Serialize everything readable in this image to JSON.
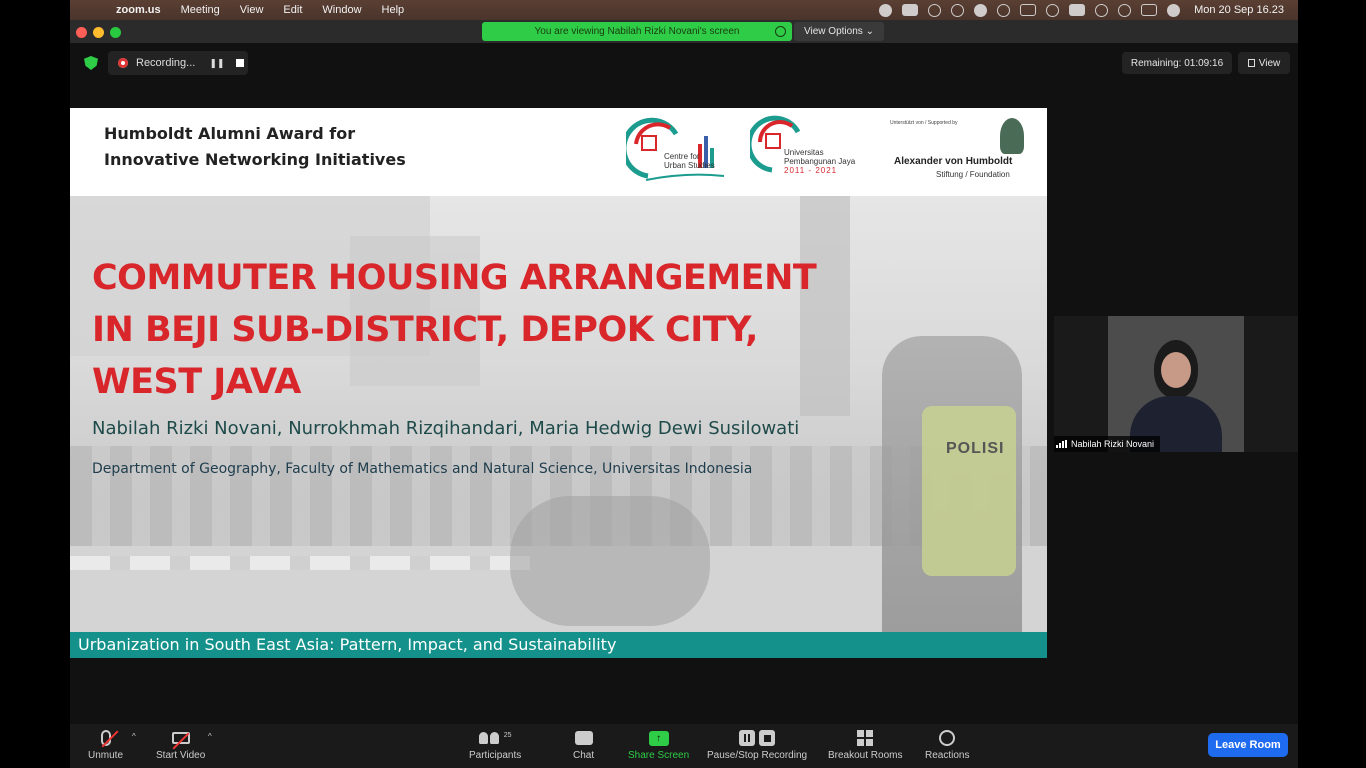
{
  "menubar": {
    "app": "zoom.us",
    "items": [
      "Meeting",
      "View",
      "Edit",
      "Window",
      "Help"
    ],
    "clock": "Mon 20 Sep  16.23"
  },
  "titlebar": {
    "viewing_banner": "You are viewing Nabilah Rizki Novani's screen",
    "view_options": "View Options"
  },
  "meeting": {
    "recording_label": "Recording...",
    "remaining": "Remaining: 01:09:16",
    "view_label": "View"
  },
  "slide": {
    "award_line1": "Humboldt Alumni Award for",
    "award_line2": "Innovative Networking Initiatives",
    "logo_centre": [
      "Centre for",
      "Urban Studies"
    ],
    "logo_university": [
      "Universitas",
      "Pembangunan Jaya",
      "2011 - 2021"
    ],
    "logo_vh_supported": "Unterstützt von / Supported by",
    "logo_vh_name": "Alexander von Humboldt",
    "logo_vh_sub": "Stiftung / Foundation",
    "title_lines": [
      "COMMUTER HOUSING ARRANGEMENT",
      "IN BEJI SUB-DISTRICT, DEPOK CITY,",
      "WEST JAVA"
    ],
    "authors": "Nabilah Rizki Novani, Nurrokhmah Rizqihandari, Maria Hedwig Dewi Susilowati",
    "department": "Department of Geography, Faculty of Mathematics and Natural Science, Universitas Indonesia",
    "footer": "Urbanization in South East Asia: Pattern, Impact, and Sustainability",
    "photo_sign": "POLISI"
  },
  "participant": {
    "name": "Nabilah Rizki Novani"
  },
  "toolbar": {
    "unmute": "Unmute",
    "start_video": "Start Video",
    "participants": "Participants",
    "participants_count": "25",
    "chat": "Chat",
    "share_screen": "Share Screen",
    "pause_stop_recording": "Pause/Stop Recording",
    "breakout_rooms": "Breakout Rooms",
    "reactions": "Reactions",
    "leave_room": "Leave Room"
  },
  "colors": {
    "title_red": "#d8262b",
    "footer_teal": "#14918a",
    "zoom_green": "#2ecc47",
    "leave_blue": "#1f6bf0"
  }
}
